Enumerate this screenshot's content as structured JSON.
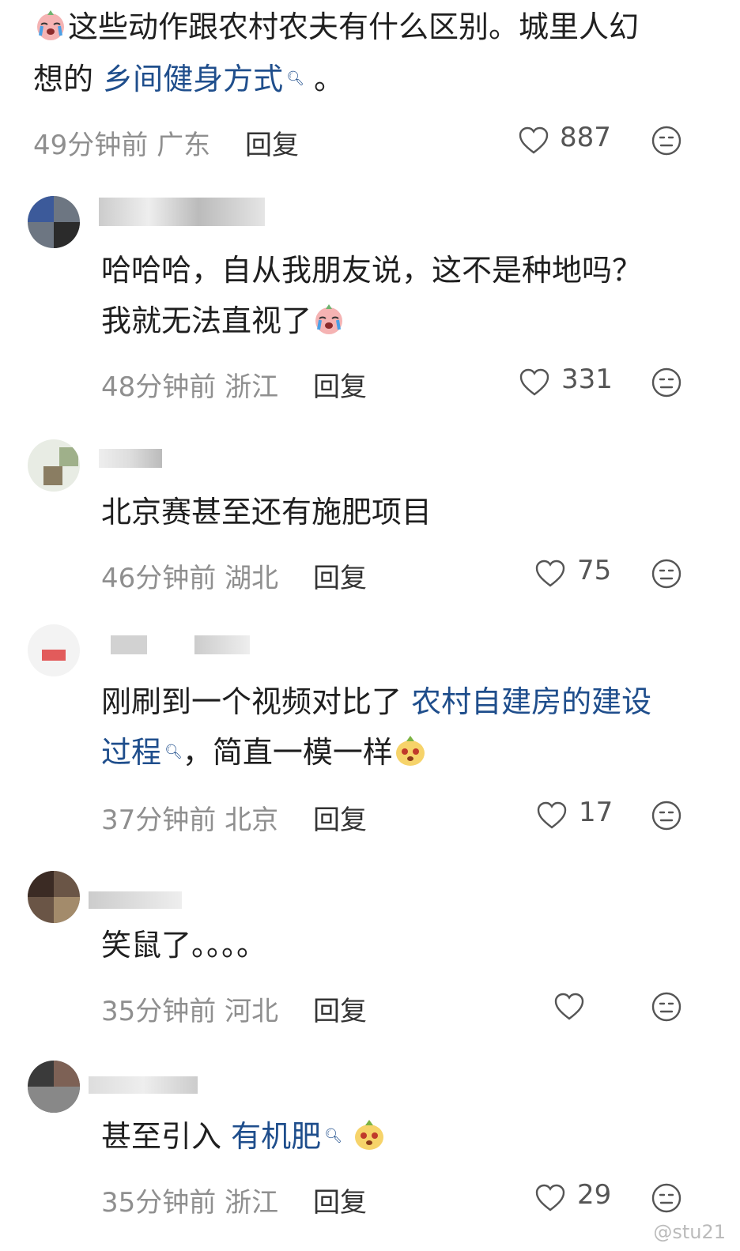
{
  "comments": [
    {
      "text_before": "这些动作跟农村农夫有什么区别。城里人幻",
      "text_line2_before": "想的 ",
      "link": "乡间健身方式",
      "text_after": " 。",
      "time": "49分钟前",
      "region": "广东",
      "reply": "回复",
      "likes": "887"
    },
    {
      "line1": "哈哈哈，自从我朋友说，这不是种地吗？",
      "line2": "我就无法直视了",
      "time": "48分钟前",
      "region": "浙江",
      "reply": "回复",
      "likes": "331"
    },
    {
      "line1": "北京赛甚至还有施肥项目",
      "time": "46分钟前",
      "region": "湖北",
      "reply": "回复",
      "likes": "75"
    },
    {
      "line1_before": "刚刷到一个视频对比了 ",
      "link_part1": "农村自建房的建设",
      "link_part2": "过程",
      "line2_after": "，简直一模一样",
      "time": "37分钟前",
      "region": "北京",
      "reply": "回复",
      "likes": "17"
    },
    {
      "line1": "笑鼠了。。。。",
      "time": "35分钟前",
      "region": "河北",
      "reply": "回复",
      "likes": ""
    },
    {
      "line1_before": "甚至引入 ",
      "link": "有机肥",
      "time": "35分钟前",
      "region": "浙江",
      "reply": "回复",
      "likes": "29"
    }
  ],
  "watermark": "@stu21",
  "icons": {
    "like": "heart-icon",
    "dislike": "neutral-face-icon",
    "search_hint": "magnifier-icon"
  }
}
